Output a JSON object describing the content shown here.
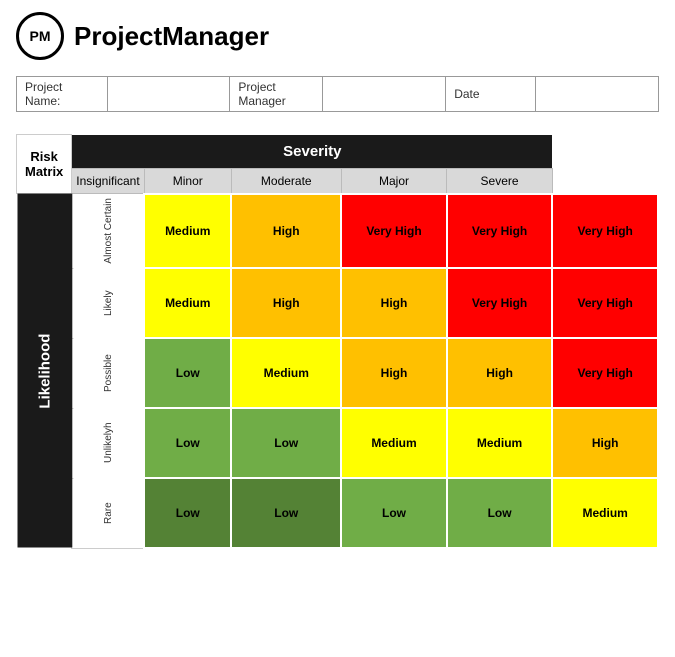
{
  "header": {
    "logo_text": "PM",
    "app_title": "ProjectManager"
  },
  "form": {
    "project_name_label": "Project Name:",
    "project_manager_label": "Project Manager",
    "date_label": "Date",
    "project_name_value": "",
    "project_manager_value": "",
    "date_value": ""
  },
  "matrix": {
    "title": "Risk Matrix",
    "severity_label": "Severity",
    "likelihood_label": "Likelihood",
    "col_headers": [
      "Insignificant",
      "Minor",
      "Moderate",
      "Major",
      "Severe"
    ],
    "row_headers": [
      "Almost Certain",
      "Likely",
      "Possible",
      "Unlikelyh",
      "Rare"
    ],
    "cells": [
      [
        "Medium",
        "High",
        "Very High",
        "Very High",
        "Very High"
      ],
      [
        "Medium",
        "High",
        "High",
        "Very High",
        "Very High"
      ],
      [
        "Low",
        "Medium",
        "High",
        "High",
        "Very High"
      ],
      [
        "Low",
        "Low",
        "Medium",
        "Medium",
        "High"
      ],
      [
        "Low",
        "Low",
        "Low",
        "Low",
        "Medium"
      ]
    ],
    "cell_colors": [
      [
        "yellow",
        "orange",
        "red",
        "red",
        "red"
      ],
      [
        "yellow",
        "orange",
        "orange",
        "red",
        "red"
      ],
      [
        "green",
        "yellow",
        "orange",
        "orange",
        "red"
      ],
      [
        "green",
        "green",
        "yellow",
        "yellow",
        "orange"
      ],
      [
        "green-dark",
        "green-dark",
        "green",
        "green",
        "yellow"
      ]
    ]
  }
}
